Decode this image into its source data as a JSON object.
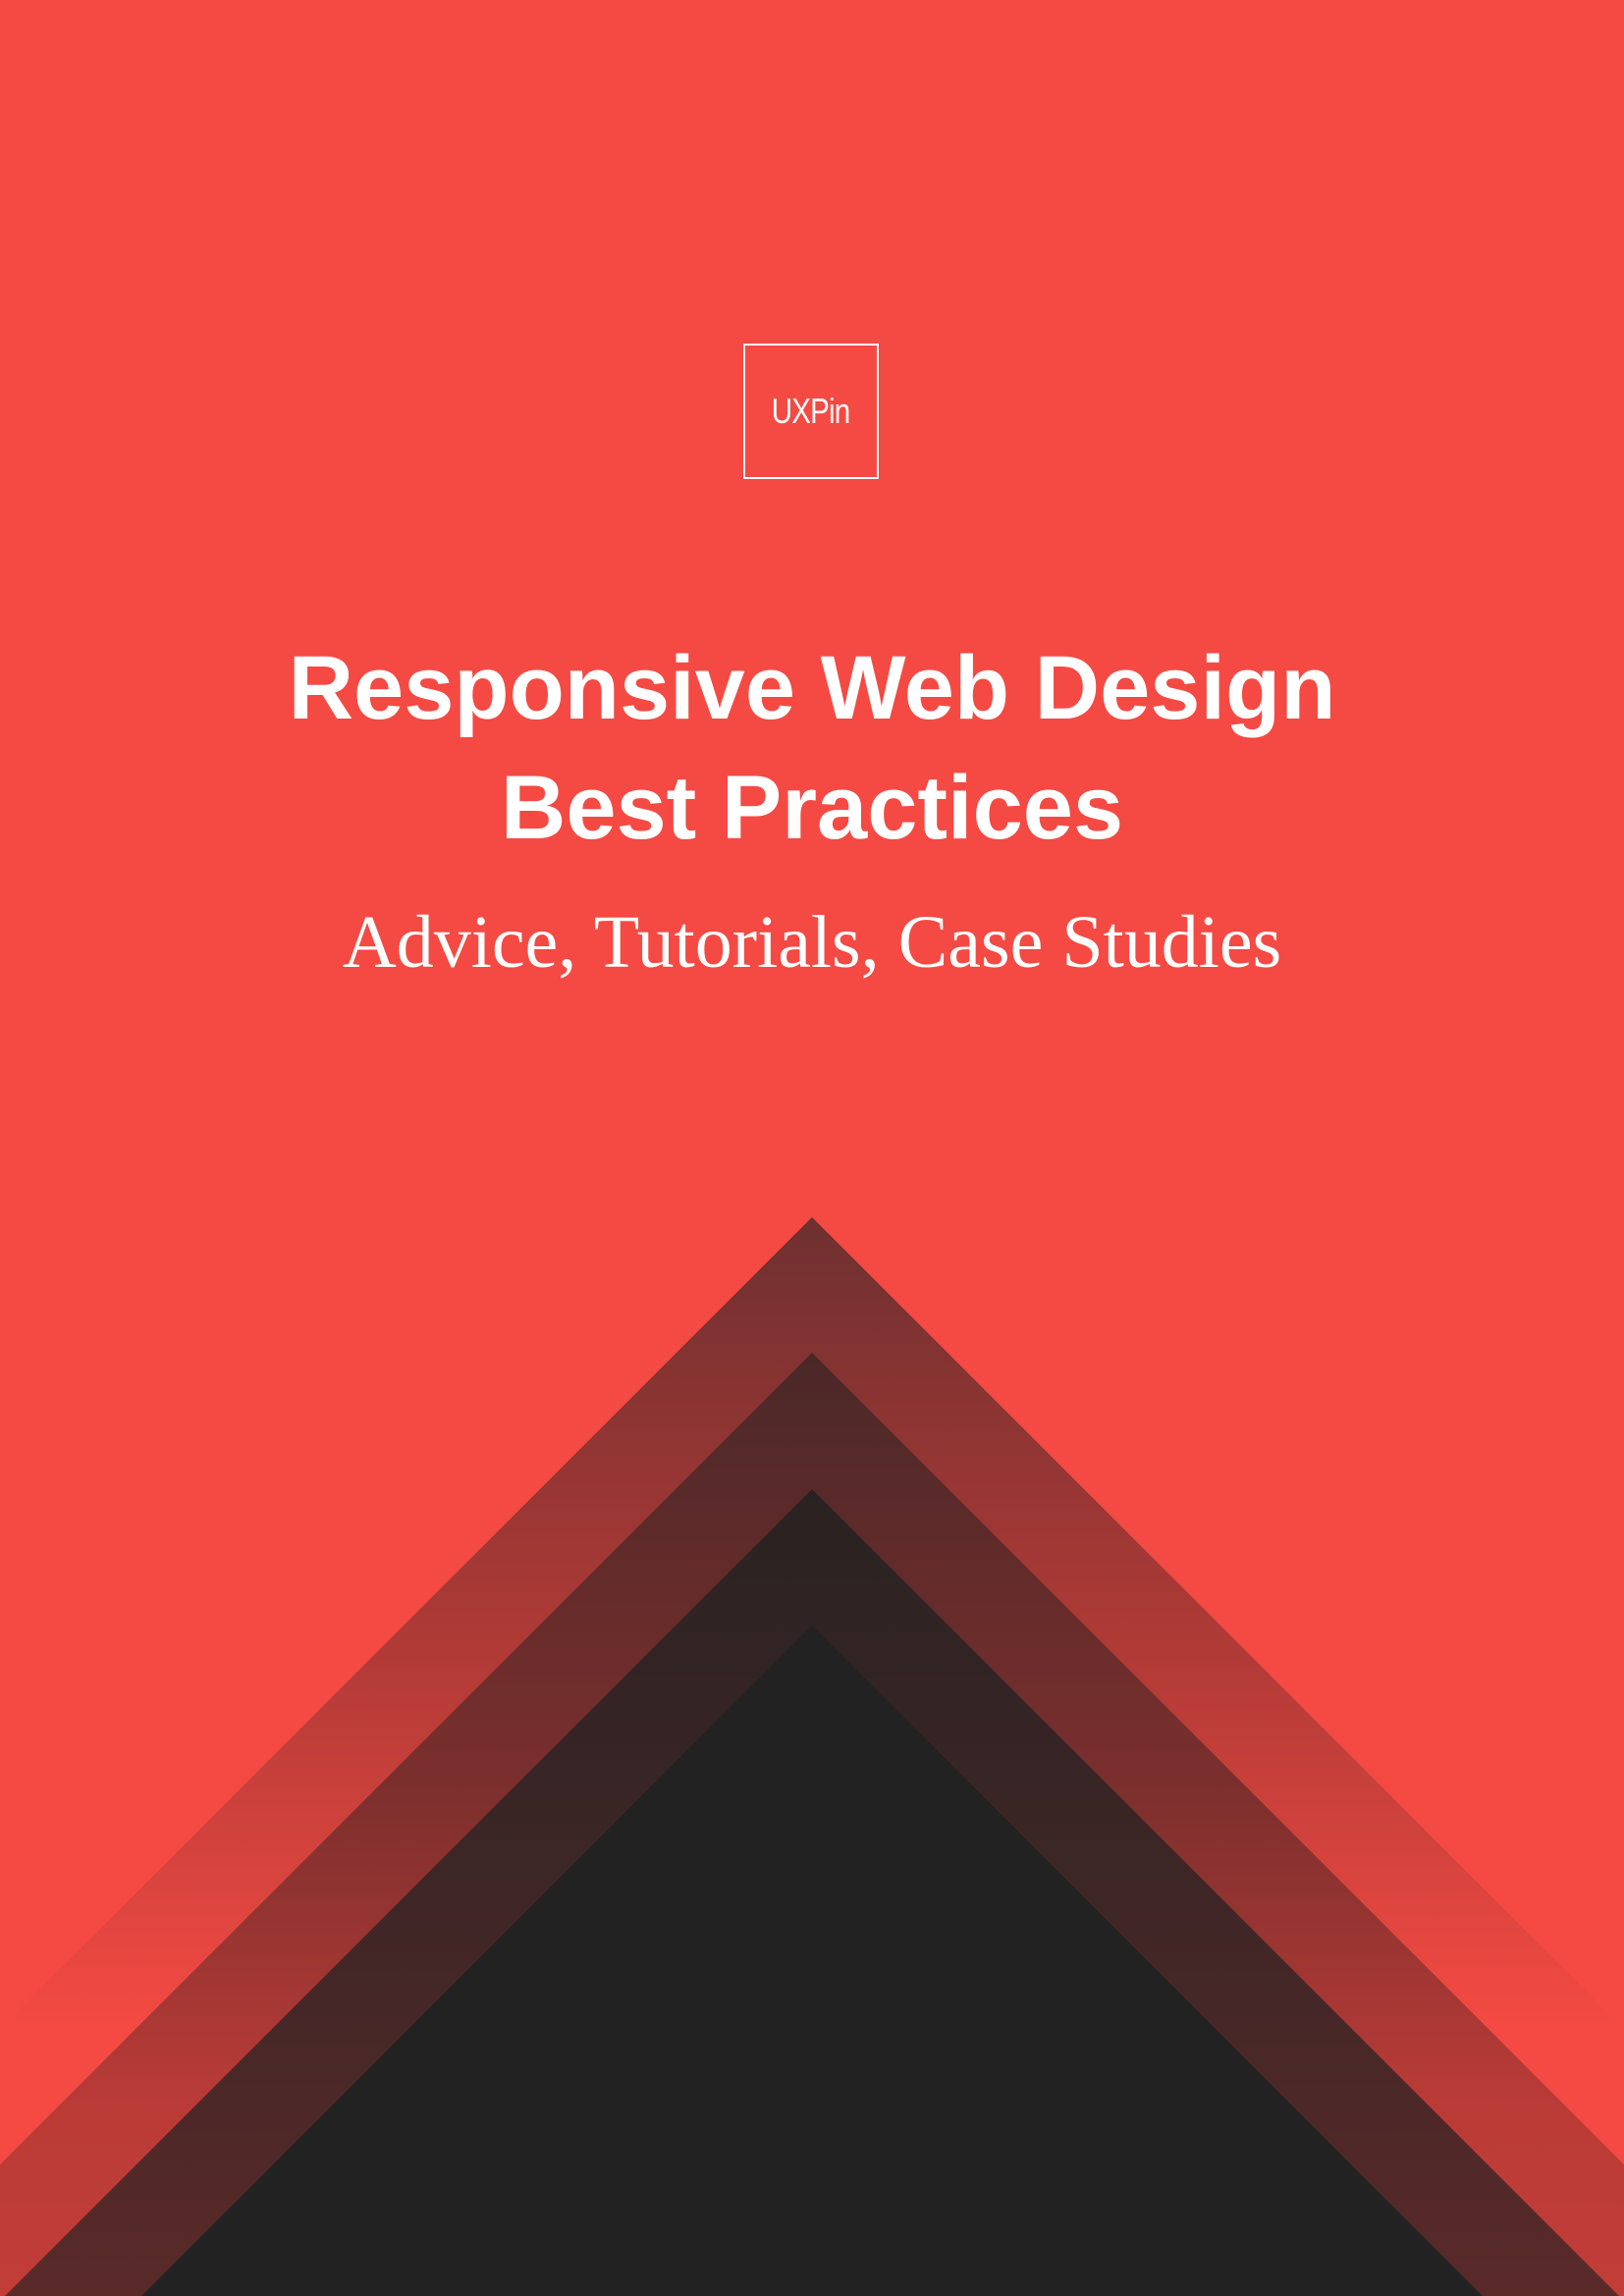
{
  "cover": {
    "logo_text": "UXPin",
    "title_line_1": "Responsive Web Design",
    "title_line_2": "Best Practices",
    "subtitle": "Advice, Tutorials, Case Studies"
  },
  "colors": {
    "background": "#f44a43",
    "text": "#ffffff",
    "dark": "#222222"
  }
}
